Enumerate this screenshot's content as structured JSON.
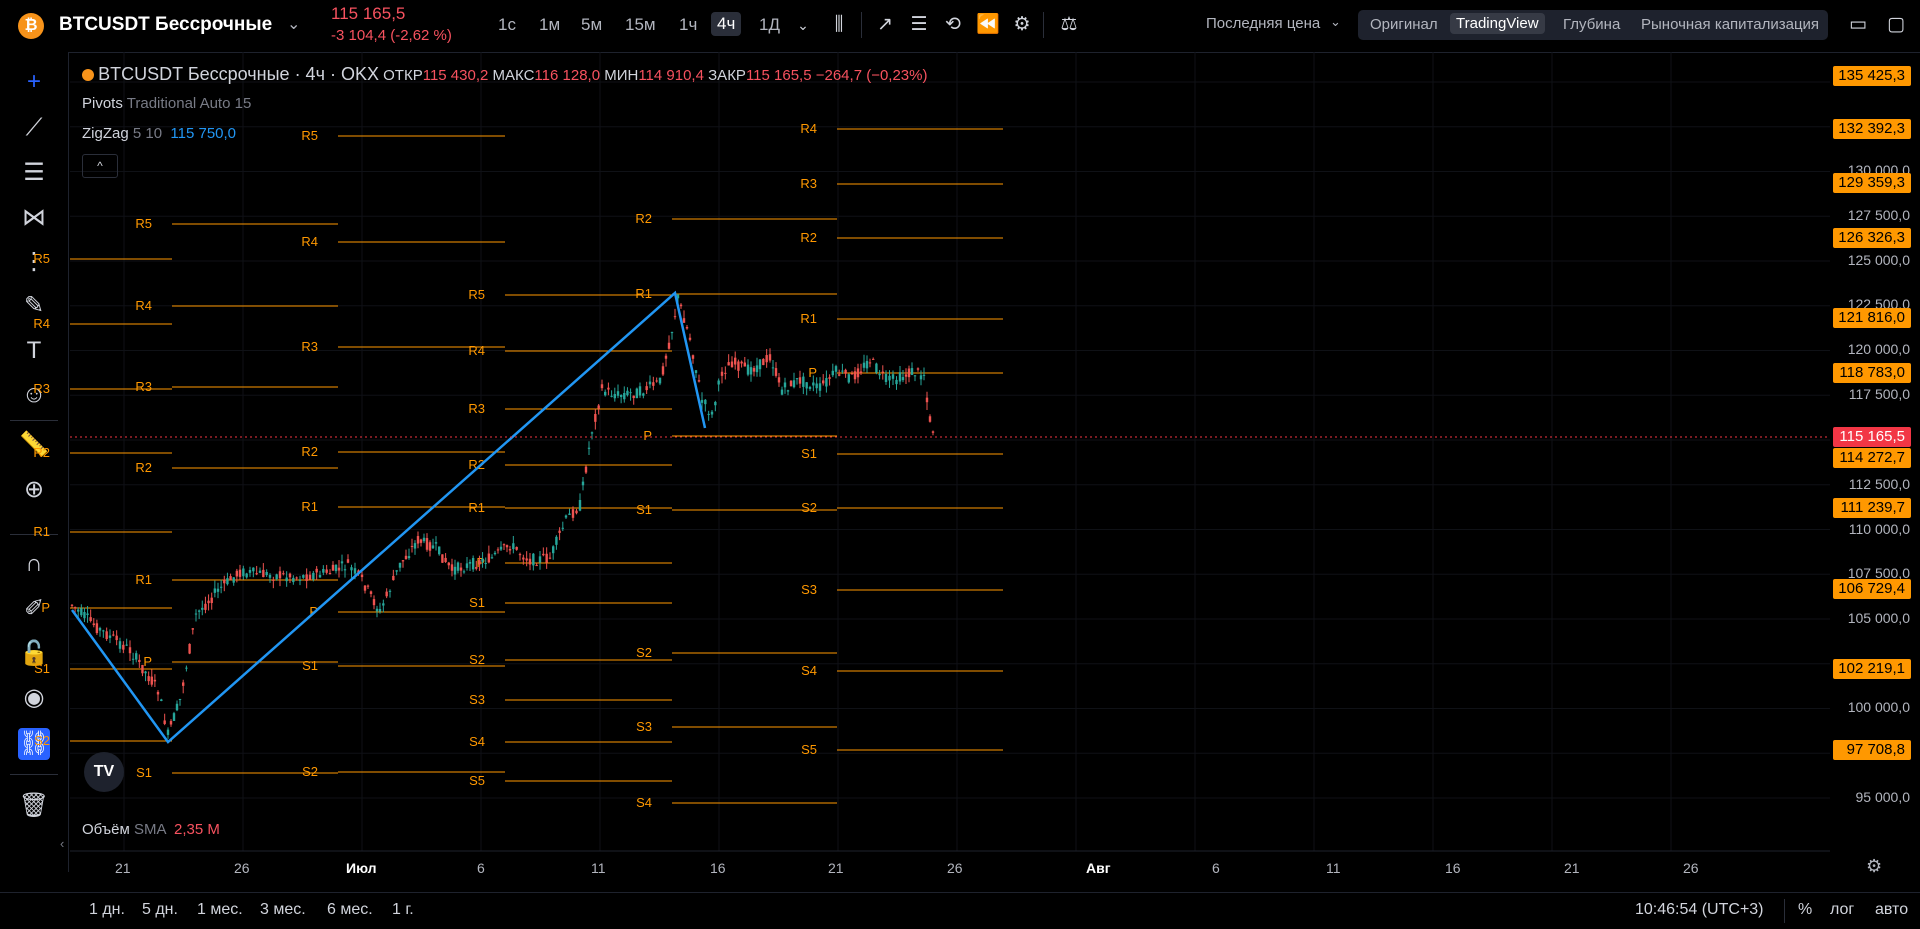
{
  "header": {
    "symbol": "BTCUSDT Бессрочные",
    "coin_glyph": "₿",
    "price": "115 165,5",
    "change": "-3 104,4 (-2,62 %)",
    "timeframes": [
      "1с",
      "1м",
      "5м",
      "15м",
      "1ч",
      "4ч",
      "1Д"
    ],
    "active_timeframe": "4ч",
    "price_type": "Последняя цена",
    "view_tabs": [
      "Оригинал",
      "TradingView",
      "Глубина",
      "Рыночная капитализация"
    ],
    "active_view": "TradingView"
  },
  "legend": {
    "title": "BTCUSDT Бессрочные · 4ч · OKX",
    "open_label": "ОТКР",
    "open": "115 430,2",
    "high_label": "МАКС",
    "high": "116 128,0",
    "low_label": "МИН",
    "low": "114 910,4",
    "close_label": "ЗАКР",
    "close": "115 165,5",
    "close_change": "−264,7 (−0,23%)",
    "pivots_name": "Pivots",
    "pivots_params": "Traditional Auto 15",
    "zigzag_name": "ZigZag",
    "zigzag_params": "5 10",
    "zigzag_value": "115 750,0",
    "volume_name": "Объём",
    "volume_ma": "SMA",
    "volume_value": "2,35 M"
  },
  "price_scale": {
    "ticks": [
      "130 000,0",
      "127 500,0",
      "125 000,0",
      "122 500,0",
      "120 000,0",
      "117 500,0",
      "112 500,0",
      "110 000,0",
      "107 500,0",
      "105 000,0",
      "100 000,0",
      "95 000,0"
    ],
    "labels": [
      "135 425,3",
      "132 392,3",
      "129 359,3",
      "126 326,3",
      "121 816,0",
      "118 783,0",
      "114 272,7",
      "111 239,7",
      "106 729,4",
      "102 219,1",
      "97 708,8"
    ],
    "current_price": "115 165,5"
  },
  "x_axis": {
    "ticks": [
      "21",
      "26",
      "Июл",
      "6",
      "11",
      "16",
      "21",
      "26",
      "Авг",
      "6",
      "11",
      "16",
      "21",
      "26"
    ]
  },
  "pivot_labels": [
    "R5",
    "R4",
    "R3",
    "R2",
    "R1",
    "P",
    "S1",
    "S2",
    "S3",
    "S4",
    "S5"
  ],
  "bottom": {
    "ranges": [
      "1 дн.",
      "5 дн.",
      "1 мес.",
      "3 мес.",
      "6 мес.",
      "1 г."
    ],
    "clock": "10:46:54 (UTC+3)",
    "percent": "%",
    "log": "лог",
    "auto": "авто"
  },
  "colors": {
    "up": "#26a69a",
    "down": "#ef5350",
    "pivot": "#ff9800",
    "zigzag": "#2196f3",
    "accent": "#2962ff"
  }
}
